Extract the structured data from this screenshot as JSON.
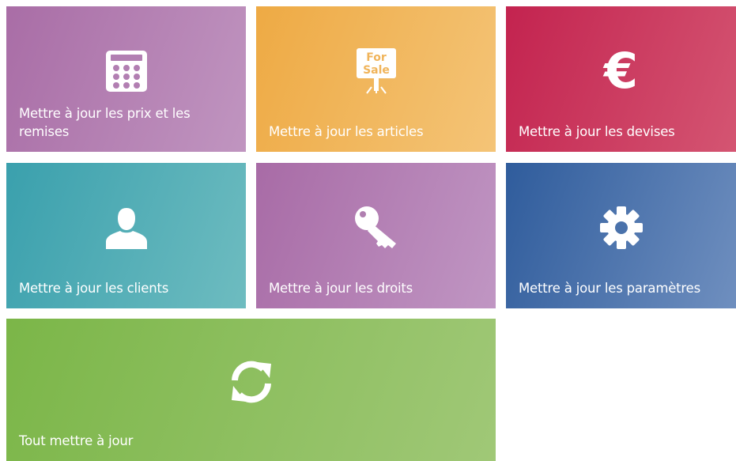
{
  "tiles": {
    "prix": {
      "label": "Mettre à jour les prix et les remises",
      "icon": "calculator-icon",
      "color": "#b07fb0"
    },
    "articles": {
      "label": "Mettre à jour les articles",
      "icon": "for-sale-sign-icon",
      "sign_text_1": "For",
      "sign_text_2": "Sale",
      "color": "#f0b45a"
    },
    "devises": {
      "label": "Mettre à jour les devises",
      "icon": "euro-icon",
      "symbol": "€",
      "color": "#c93a5e"
    },
    "clients": {
      "label": "Mettre à jour les clients",
      "icon": "user-icon",
      "color": "#4fadb5"
    },
    "droits": {
      "label": "Mettre à jour les droits",
      "icon": "key-icon",
      "color": "#b07fb0"
    },
    "params": {
      "label": "Mettre à jour les paramètres",
      "icon": "gear-icon",
      "color": "#4a72ab"
    },
    "all": {
      "label": "Tout mettre à jour",
      "icon": "refresh-icon",
      "color": "#8cbf5e"
    }
  }
}
